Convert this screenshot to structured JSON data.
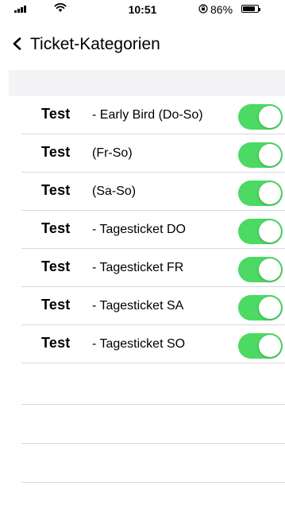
{
  "status_bar": {
    "time": "10:51",
    "battery_percent": "86%",
    "battery_level": 0.86,
    "signal_bars": 4
  },
  "nav": {
    "title": "Ticket-Kategorien",
    "back_icon": "chevron-left-icon"
  },
  "categories": [
    {
      "name": "Test",
      "description": "- Early Bird (Do-So)",
      "enabled": true
    },
    {
      "name": "Test",
      "description": "(Fr-So)",
      "enabled": true
    },
    {
      "name": "Test",
      "description": "(Sa-So)",
      "enabled": true
    },
    {
      "name": "Test",
      "description": "- Tagesticket DO",
      "enabled": true
    },
    {
      "name": "Test",
      "description": "- Tagesticket FR",
      "enabled": true
    },
    {
      "name": "Test",
      "description": "- Tagesticket SA",
      "enabled": true
    },
    {
      "name": "Test",
      "description": "- Tagesticket SO",
      "enabled": true
    }
  ],
  "colors": {
    "toggle_on": "#4cd964",
    "separator": "#d9d9de",
    "section_header": "#f4f4f6"
  }
}
